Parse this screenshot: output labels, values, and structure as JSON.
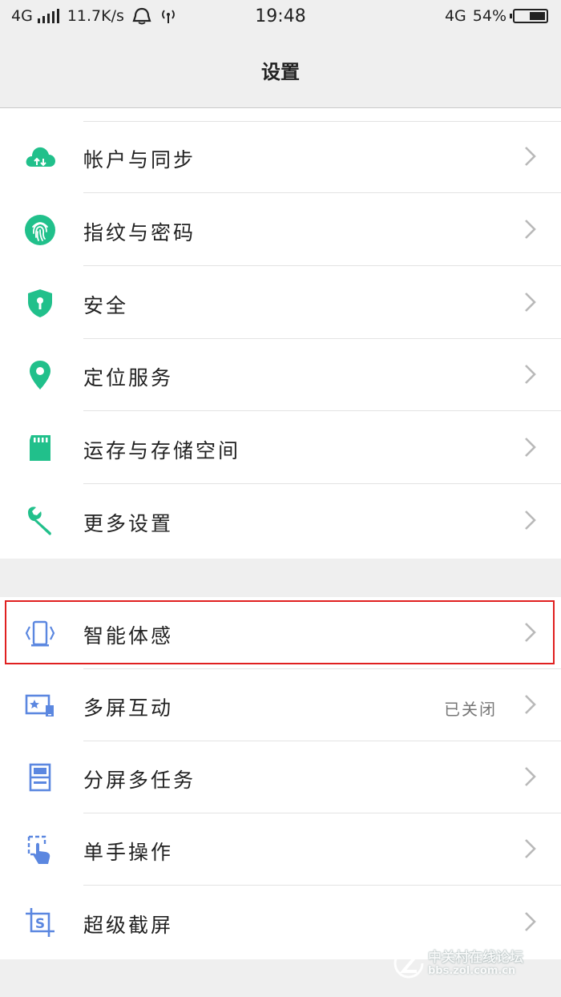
{
  "status_bar": {
    "network_left": "4G",
    "speed": "11.7K/s",
    "time": "19:48",
    "network_right": "4G",
    "battery": "54%",
    "battery_level": 0.54
  },
  "header": {
    "title": "设置"
  },
  "colors": {
    "green_icon": "#21c08b",
    "blue_icon": "#5b87e0",
    "highlight": "#e02020"
  },
  "group1": [
    {
      "label": "帐户与同步",
      "icon": "cloud-sync-icon"
    },
    {
      "label": "指纹与密码",
      "icon": "fingerprint-icon"
    },
    {
      "label": "安全",
      "icon": "shield-icon"
    },
    {
      "label": "定位服务",
      "icon": "location-pin-icon"
    },
    {
      "label": "运存与存储空间",
      "icon": "sd-card-icon"
    },
    {
      "label": "更多设置",
      "icon": "wrench-icon"
    }
  ],
  "group2": [
    {
      "label": "智能体感",
      "icon": "phone-motion-icon",
      "value": ""
    },
    {
      "label": "多屏互动",
      "icon": "screen-cast-icon",
      "value": "已关闭"
    },
    {
      "label": "分屏多任务",
      "icon": "split-screen-icon",
      "value": ""
    },
    {
      "label": "单手操作",
      "icon": "one-hand-icon",
      "value": ""
    },
    {
      "label": "超级截屏",
      "icon": "screenshot-icon",
      "value": ""
    }
  ],
  "watermark": {
    "text": "中关村在线论坛",
    "url": "bbs.zol.com.cn"
  }
}
